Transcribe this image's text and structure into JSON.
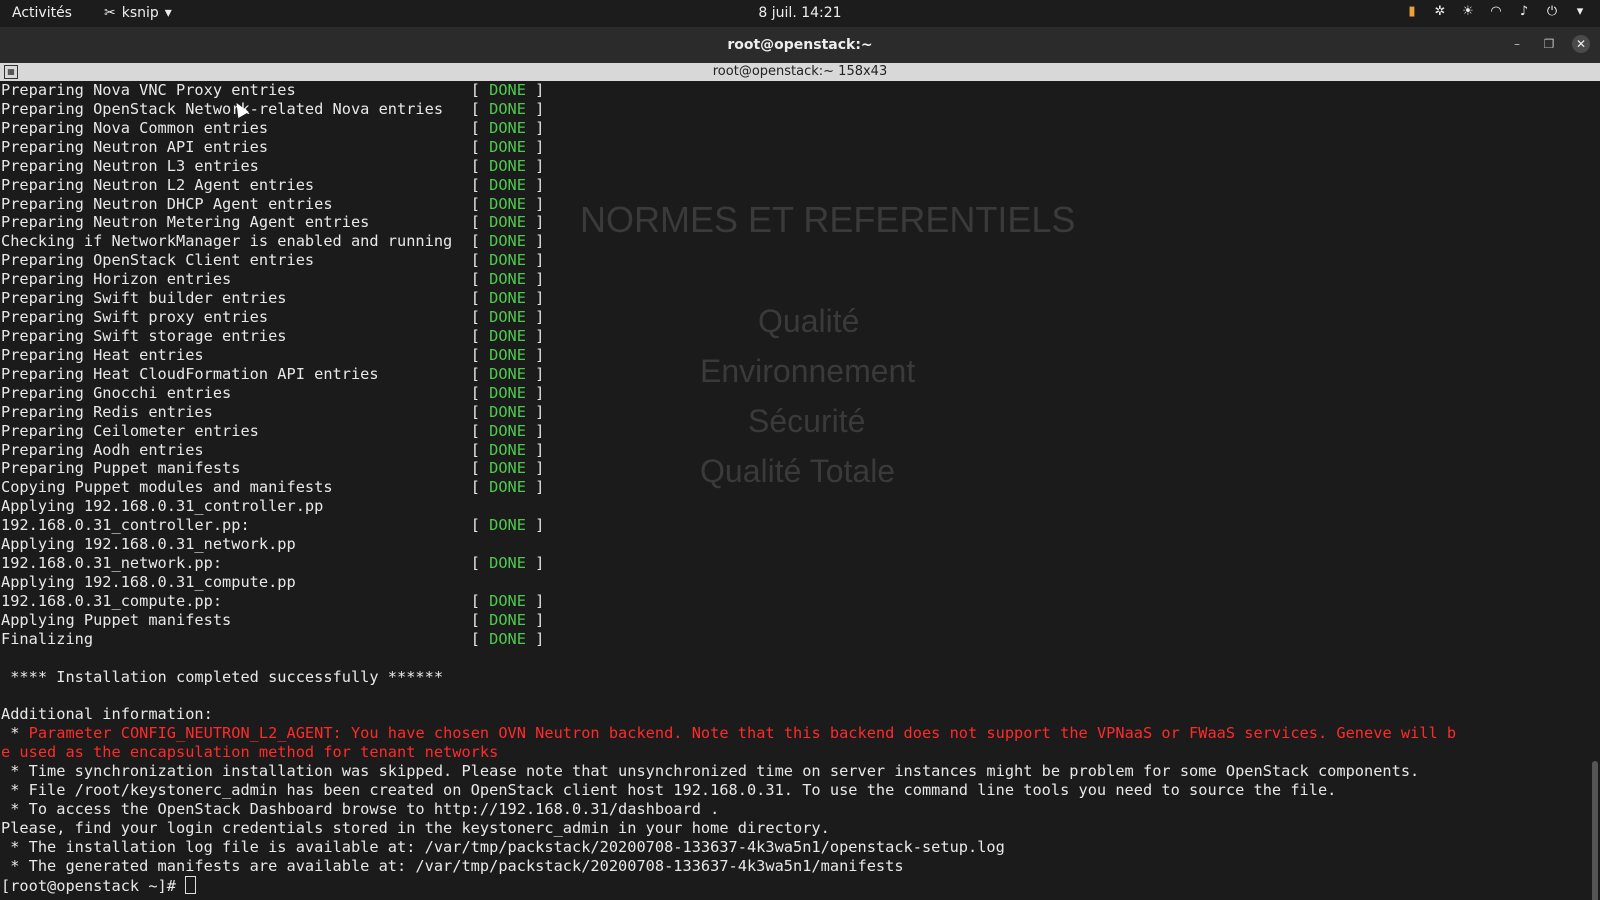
{
  "topbar": {
    "activities": "Activités",
    "app_name": "ksnip",
    "clock": "8 juil.  14:21"
  },
  "window": {
    "title": "root@openstack:~",
    "terminal_header": "root@openstack:~ 158x43"
  },
  "background_ghost": {
    "heading": "NORMES ET REFERENTIELS",
    "slide_words": [
      "Qualité",
      "Environnement",
      "Sécurité",
      "Qualité Totale"
    ]
  },
  "terminal": {
    "lines": [
      {
        "text": "Preparing Nova VNC Proxy entries                   ",
        "status": "DONE"
      },
      {
        "text": "Preparing OpenStack Network-related Nova entries   ",
        "status": "DONE"
      },
      {
        "text": "Preparing Nova Common entries                      ",
        "status": "DONE"
      },
      {
        "text": "Preparing Neutron API entries                      ",
        "status": "DONE"
      },
      {
        "text": "Preparing Neutron L3 entries                       ",
        "status": "DONE"
      },
      {
        "text": "Preparing Neutron L2 Agent entries                 ",
        "status": "DONE"
      },
      {
        "text": "Preparing Neutron DHCP Agent entries               ",
        "status": "DONE"
      },
      {
        "text": "Preparing Neutron Metering Agent entries           ",
        "status": "DONE"
      },
      {
        "text": "Checking if NetworkManager is enabled and running  ",
        "status": "DONE"
      },
      {
        "text": "Preparing OpenStack Client entries                 ",
        "status": "DONE"
      },
      {
        "text": "Preparing Horizon entries                          ",
        "status": "DONE"
      },
      {
        "text": "Preparing Swift builder entries                    ",
        "status": "DONE"
      },
      {
        "text": "Preparing Swift proxy entries                      ",
        "status": "DONE"
      },
      {
        "text": "Preparing Swift storage entries                    ",
        "status": "DONE"
      },
      {
        "text": "Preparing Heat entries                             ",
        "status": "DONE"
      },
      {
        "text": "Preparing Heat CloudFormation API entries          ",
        "status": "DONE"
      },
      {
        "text": "Preparing Gnocchi entries                          ",
        "status": "DONE"
      },
      {
        "text": "Preparing Redis entries                            ",
        "status": "DONE"
      },
      {
        "text": "Preparing Ceilometer entries                       ",
        "status": "DONE"
      },
      {
        "text": "Preparing Aodh entries                             ",
        "status": "DONE"
      },
      {
        "text": "Preparing Puppet manifests                         ",
        "status": "DONE"
      },
      {
        "text": "Copying Puppet modules and manifests               ",
        "status": "DONE"
      },
      {
        "text": "Applying 192.168.0.31_controller.pp",
        "status": ""
      },
      {
        "text": "192.168.0.31_controller.pp:                        ",
        "status": "DONE"
      },
      {
        "text": "Applying 192.168.0.31_network.pp",
        "status": ""
      },
      {
        "text": "192.168.0.31_network.pp:                           ",
        "status": "DONE"
      },
      {
        "text": "Applying 192.168.0.31_compute.pp",
        "status": ""
      },
      {
        "text": "192.168.0.31_compute.pp:                           ",
        "status": "DONE"
      },
      {
        "text": "Applying Puppet manifests                          ",
        "status": "DONE"
      },
      {
        "text": "Finalizing                                         ",
        "status": "DONE"
      },
      {
        "text": "",
        "status": ""
      },
      {
        "text": " **** Installation completed successfully ******",
        "status": ""
      },
      {
        "text": "",
        "status": ""
      },
      {
        "text": "Additional information:",
        "status": ""
      }
    ],
    "warning_prefix": " * ",
    "warning_line1": "Parameter CONFIG_NEUTRON_L2_AGENT: You have chosen OVN Neutron backend. Note that this backend does not support the VPNaaS or FWaaS services. Geneve will b",
    "warning_line2": "e used as the encapsulation method for tenant networks",
    "info_lines": [
      " * Time synchronization installation was skipped. Please note that unsynchronized time on server instances might be problem for some OpenStack components.",
      " * File /root/keystonerc_admin has been created on OpenStack client host 192.168.0.31. To use the command line tools you need to source the file.",
      " * To access the OpenStack Dashboard browse to http://192.168.0.31/dashboard .",
      "Please, find your login credentials stored in the keystonerc_admin in your home directory.",
      " * The installation log file is available at: /var/tmp/packstack/20200708-133637-4k3wa5n1/openstack-setup.log",
      " * The generated manifests are available at: /var/tmp/packstack/20200708-133637-4k3wa5n1/manifests"
    ],
    "prompt": "[root@openstack ~]# "
  }
}
